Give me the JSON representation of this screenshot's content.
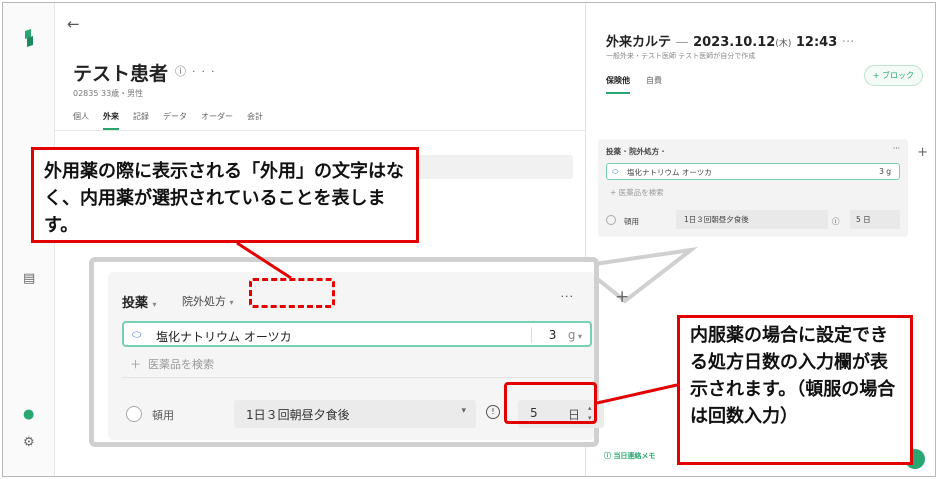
{
  "patient": {
    "name": "テスト患者",
    "meta": "02835  33歳・男性",
    "tabs": [
      "個人",
      "外来",
      "記録",
      "データ",
      "オーダー",
      "会計"
    ]
  },
  "karte": {
    "title": "外来カルテ",
    "date": "2023.10.12",
    "weekday": "(木)",
    "time": "12:43",
    "subtitle": "一般外来・テスト医師   テスト医師が自分で作成",
    "tabs": [
      "保険他",
      "自費"
    ],
    "block_button": "+ ブロック",
    "mini_header": "投薬 ·    院外処方 ·",
    "mini_drug": "塩化ナトリウム オーツカ",
    "mini_qty": "3  g",
    "mini_add": "+  医薬品を検索",
    "mini_radio": "頓用",
    "mini_usage": "1日３回朝昼夕食後",
    "mini_days": "5     日",
    "footer_memo": "当日連絡メモ"
  },
  "prescription": {
    "title": "投薬",
    "type": "院外処方",
    "drug_name": "塩化ナトリウム オーツカ",
    "quantity": "3",
    "unit": "g",
    "add_placeholder": "医薬品を検索",
    "tonyo_label": "頓用",
    "usage": "1日３回朝昼夕食後",
    "days": "5",
    "days_unit": "日"
  },
  "annotations": {
    "note1": "外用薬の際に表示される「外用」の文字はなく、内用薬が選択されていることを表します。",
    "note2": "内服薬の場合に設定できる処方日数の入力欄が表示されます。（頓服の場合は回数入力）"
  },
  "colors": {
    "accent": "#2aa672",
    "annotation": "#e30000",
    "pill_icon": "#4a78d8"
  }
}
